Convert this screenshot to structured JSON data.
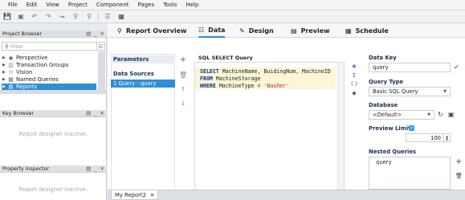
{
  "menu": [
    "File",
    "Edit",
    "View",
    "Project",
    "Component",
    "Pages",
    "Tools",
    "Help"
  ],
  "toolbar_icons": [
    "save-icon",
    "save-all-icon",
    "undo-icon",
    "redo-icon",
    "merge-icon",
    "lock-icon",
    "unlock-icon",
    "stack-icon",
    "grid-icon"
  ],
  "project_browser": {
    "title": "Project Browser",
    "filter_placeholder": "Filter",
    "items": [
      {
        "label": "Perspective",
        "icon": "perspective-icon"
      },
      {
        "label": "Transaction Groups",
        "icon": "transaction-groups-icon"
      },
      {
        "label": "Vision",
        "icon": "vision-icon"
      },
      {
        "label": "Named Queries",
        "icon": "named-queries-icon"
      },
      {
        "label": "Reports",
        "icon": "reports-icon"
      }
    ]
  },
  "key_browser": {
    "title": "Key Browser",
    "message": "Report designer inactive."
  },
  "property_inspector": {
    "title": "Property Inspector",
    "message": "Report designer inactive."
  },
  "tabs": [
    {
      "label": "Report Overview",
      "icon": "report-overview-icon"
    },
    {
      "label": "Data",
      "icon": "data-icon"
    },
    {
      "label": "Design",
      "icon": "design-icon"
    },
    {
      "label": "Preview",
      "icon": "preview-icon"
    },
    {
      "label": "Schedule",
      "icon": "schedule-icon"
    }
  ],
  "data_panel": {
    "parameters_label": "Parameters",
    "data_sources_label": "Data Sources",
    "data_source_item": "1 Query - query",
    "sql_title": "SQL SELECT Query",
    "sql_lines": [
      {
        "kw": "SELECT",
        "rest": " MachineName, BuidingNum, MachineID"
      },
      {
        "kw": "FROM",
        "rest": " MachineStorage"
      },
      {
        "kw": "WHERE",
        "rest": " MachineType = ",
        "str": "'Washer'"
      }
    ]
  },
  "properties": {
    "data_key_label": "Data Key",
    "data_key_value": "query",
    "query_type_label": "Query Type",
    "query_type_value": "Basic SQL Query",
    "database_label": "Database",
    "database_value": "<Default>",
    "preview_limit_label": "Preview Limit",
    "preview_limit_value": "100",
    "nested_queries_label": "Nested Queries",
    "nested_query_item": "query"
  },
  "bottom_tab": {
    "label": "My Report2"
  },
  "colors": {
    "accent": "#2f8ed8",
    "keyword": "#0b2e8a",
    "string": "#b12a2a",
    "highlight": "#fbf6d6"
  }
}
